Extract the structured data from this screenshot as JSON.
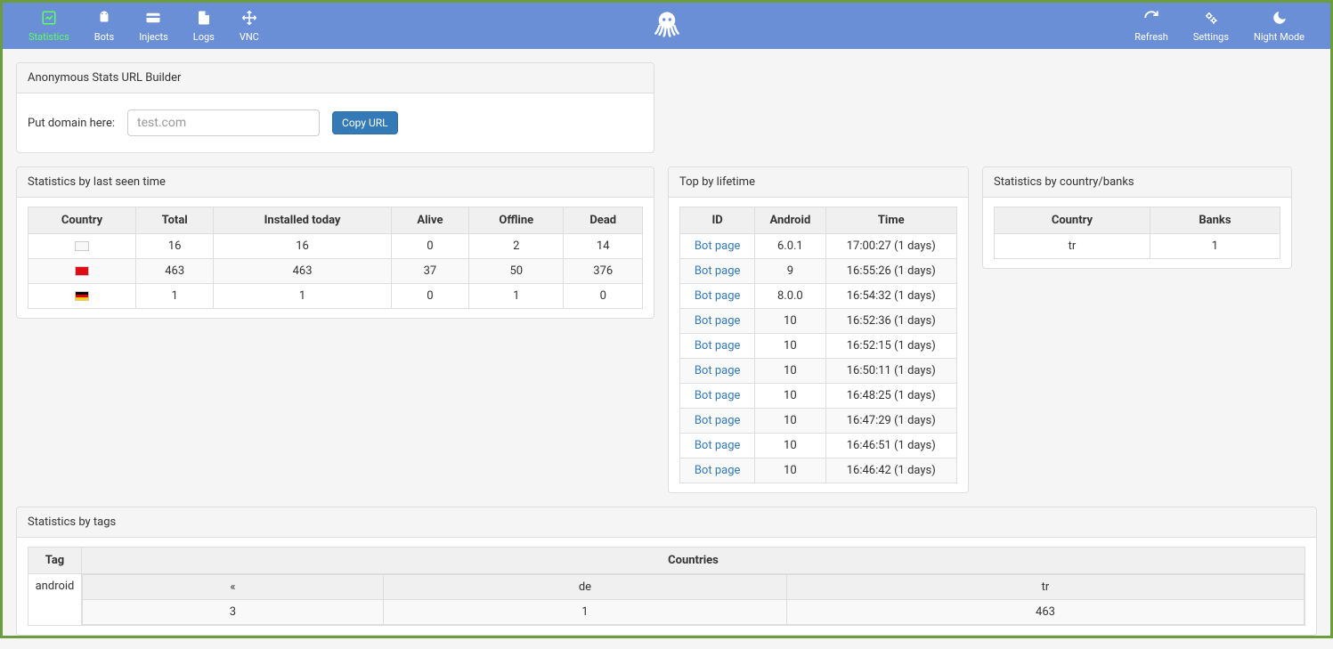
{
  "nav": {
    "left": [
      {
        "label": "Statistics",
        "icon": "chart",
        "active": true
      },
      {
        "label": "Bots",
        "icon": "android",
        "active": false
      },
      {
        "label": "Injects",
        "icon": "card",
        "active": false
      },
      {
        "label": "Logs",
        "icon": "file",
        "active": false
      },
      {
        "label": "VNC",
        "icon": "move",
        "active": false
      }
    ],
    "right": [
      {
        "label": "Refresh",
        "icon": "refresh"
      },
      {
        "label": "Settings",
        "icon": "gears"
      },
      {
        "label": "Night Mode",
        "icon": "moon"
      }
    ]
  },
  "url_builder": {
    "title": "Anonymous Stats URL Builder",
    "label": "Put domain here:",
    "placeholder": "test.com",
    "button": "Copy URL"
  },
  "stats_time": {
    "title": "Statistics by last seen time",
    "headers": [
      "Country",
      "Total",
      "Installed today",
      "Alive",
      "Offline",
      "Dead"
    ],
    "rows": [
      {
        "flag": "blank",
        "total": "16",
        "installed": "16",
        "alive": "0",
        "offline": "2",
        "dead": "14"
      },
      {
        "flag": "tr",
        "total": "463",
        "installed": "463",
        "alive": "37",
        "offline": "50",
        "dead": "376"
      },
      {
        "flag": "de",
        "total": "1",
        "installed": "1",
        "alive": "0",
        "offline": "1",
        "dead": "0"
      }
    ]
  },
  "lifetime": {
    "title": "Top by lifetime",
    "headers": [
      "ID",
      "Android",
      "Time"
    ],
    "link_label": "Bot page",
    "rows": [
      {
        "android": "6.0.1",
        "time": "17:00:27 (1 days)"
      },
      {
        "android": "9",
        "time": "16:55:26 (1 days)"
      },
      {
        "android": "8.0.0",
        "time": "16:54:32 (1 days)"
      },
      {
        "android": "10",
        "time": "16:52:36 (1 days)"
      },
      {
        "android": "10",
        "time": "16:52:15 (1 days)"
      },
      {
        "android": "10",
        "time": "16:50:11 (1 days)"
      },
      {
        "android": "10",
        "time": "16:48:25 (1 days)"
      },
      {
        "android": "10",
        "time": "16:47:29 (1 days)"
      },
      {
        "android": "10",
        "time": "16:46:51 (1 days)"
      },
      {
        "android": "10",
        "time": "16:46:42 (1 days)"
      }
    ]
  },
  "banks": {
    "title": "Statistics by country/banks",
    "headers": [
      "Country",
      "Banks"
    ],
    "rows": [
      {
        "country": "tr",
        "banks": "1"
      }
    ]
  },
  "tags": {
    "title": "Statistics by tags",
    "headers": [
      "Tag",
      "Countries"
    ],
    "tag_name": "android",
    "countries_header": [
      "«",
      "de",
      "tr"
    ],
    "countries_values": [
      "3",
      "1",
      "463"
    ]
  }
}
